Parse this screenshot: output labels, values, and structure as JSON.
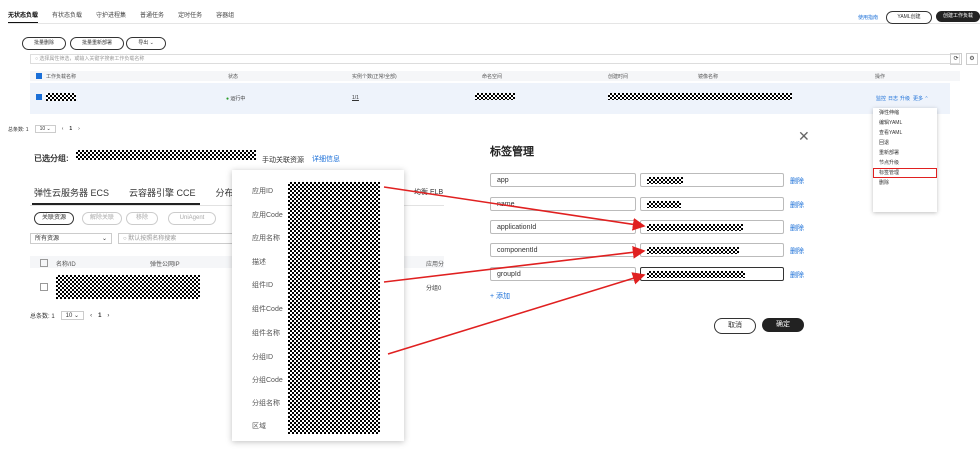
{
  "top_tabs": [
    {
      "label": "无状态负载",
      "active": true
    },
    {
      "label": "有状态负载",
      "active": false
    },
    {
      "label": "守护进程集",
      "active": false
    },
    {
      "label": "普通任务",
      "active": false
    },
    {
      "label": "定时任务",
      "active": false
    },
    {
      "label": "容器组",
      "active": false
    }
  ],
  "top_right": {
    "guide_link": "使用指南",
    "yaml_button": "YAML创建",
    "create_button": "创建工作负载"
  },
  "toolbar": {
    "batch_delete": "批量删除",
    "batch_redeploy": "批量重新部署",
    "export": "导出"
  },
  "search": {
    "placeholder": "选择属性筛选，或输入关键字搜索工作负载名称"
  },
  "table": {
    "columns": [
      "工作负载名称",
      "状态",
      "实例个数(正常/全部)",
      "命名空间",
      "创建时间",
      "镜像名称",
      "操作"
    ],
    "row": {
      "status": "运行中",
      "instances": "1/1",
      "actions": [
        "监控",
        "日志",
        "升级",
        "更多"
      ]
    }
  },
  "pagination": {
    "total_label": "总条数: 1",
    "page_size": "10",
    "page": "1"
  },
  "more_menu": [
    "弹性伸缩",
    "编辑YAML",
    "查看YAML",
    "回退",
    "重新部署",
    "节点升级",
    "标签管理",
    "删除"
  ],
  "colors": {
    "accent": "#1a6fd8",
    "highlight": "#e02020",
    "arrow": "#e02020",
    "row_bg": "#eef3fb"
  },
  "group_panel": {
    "selected_label": "已选分组:",
    "manual_link": "手动关联资源",
    "detail_link": "详细信息",
    "tabs": [
      "弹性云服务器 ECS",
      "云容器引擎 CCE",
      "分布式缓存",
      "均衡 ELB"
    ],
    "buttons": [
      "关联资源",
      "解除关联",
      "移除",
      "UniAgent"
    ],
    "filter": {
      "select": "所有资源",
      "placeholder": "默认按照名称搜索"
    },
    "columns": [
      "名称/ID",
      "弹性公网IP",
      "应用分"
    ],
    "cell_extra": "分组0",
    "pagination": {
      "total_label": "总条数: 1",
      "page_size": "10",
      "page": "1"
    }
  },
  "detail_popover": {
    "labels": [
      "应用ID",
      "应用Code",
      "应用名称",
      "描述",
      "组件ID",
      "组件Code",
      "组件名称",
      "分组ID",
      "分组Code",
      "分组名称",
      "区域"
    ]
  },
  "tag_dialog": {
    "title": "标签管理",
    "tags": [
      {
        "key": "app"
      },
      {
        "key": "name"
      },
      {
        "key": "applicationId"
      },
      {
        "key": "componentId"
      },
      {
        "key": "groupId"
      }
    ],
    "delete_label": "删除",
    "add_label": "+ 添加",
    "cancel": "取消",
    "confirm": "确定",
    "close_icon": "close-icon"
  }
}
